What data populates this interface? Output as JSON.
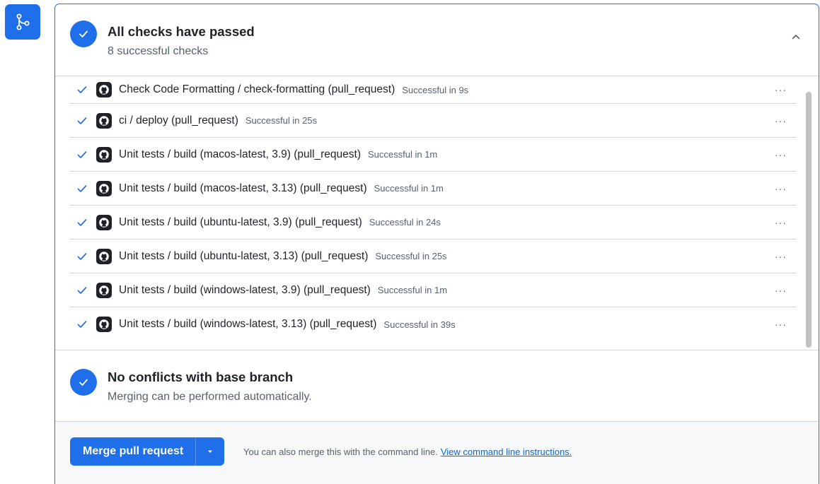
{
  "colors": {
    "accent": "#1f6feb",
    "text": "#1f2328",
    "muted": "#59636e",
    "link": "#0969da",
    "border": "#d1d9e0"
  },
  "icons": {
    "branch": "git-merge-icon",
    "success": "check-icon",
    "provider": "github-icon",
    "collapse": "chevron-up-icon",
    "row_menu": "kebab-horizontal-icon",
    "dropdown": "triangle-down-icon"
  },
  "checks_section": {
    "title": "All checks have passed",
    "subtitle": "8 successful checks",
    "expanded": true
  },
  "checks": [
    {
      "name": "Check Code Formatting / check-formatting (pull_request)",
      "status": "Successful in 9s",
      "menu": "···"
    },
    {
      "name": "ci / deploy (pull_request)",
      "status": "Successful in 25s",
      "menu": "···"
    },
    {
      "name": "Unit tests / build (macos-latest, 3.9) (pull_request)",
      "status": "Successful in 1m",
      "menu": "···"
    },
    {
      "name": "Unit tests / build (macos-latest, 3.13) (pull_request)",
      "status": "Successful in 1m",
      "menu": "···"
    },
    {
      "name": "Unit tests / build (ubuntu-latest, 3.9) (pull_request)",
      "status": "Successful in 24s",
      "menu": "···"
    },
    {
      "name": "Unit tests / build (ubuntu-latest, 3.13) (pull_request)",
      "status": "Successful in 25s",
      "menu": "···"
    },
    {
      "name": "Unit tests / build (windows-latest, 3.9) (pull_request)",
      "status": "Successful in 1m",
      "menu": "···"
    },
    {
      "name": "Unit tests / build (windows-latest, 3.13) (pull_request)",
      "status": "Successful in 39s",
      "menu": "···"
    }
  ],
  "conflicts_section": {
    "title": "No conflicts with base branch",
    "subtitle": "Merging can be performed automatically."
  },
  "merge": {
    "button_label": "Merge pull request",
    "help_text": "You can also merge this with the command line.",
    "link_text": "View command line instructions."
  }
}
